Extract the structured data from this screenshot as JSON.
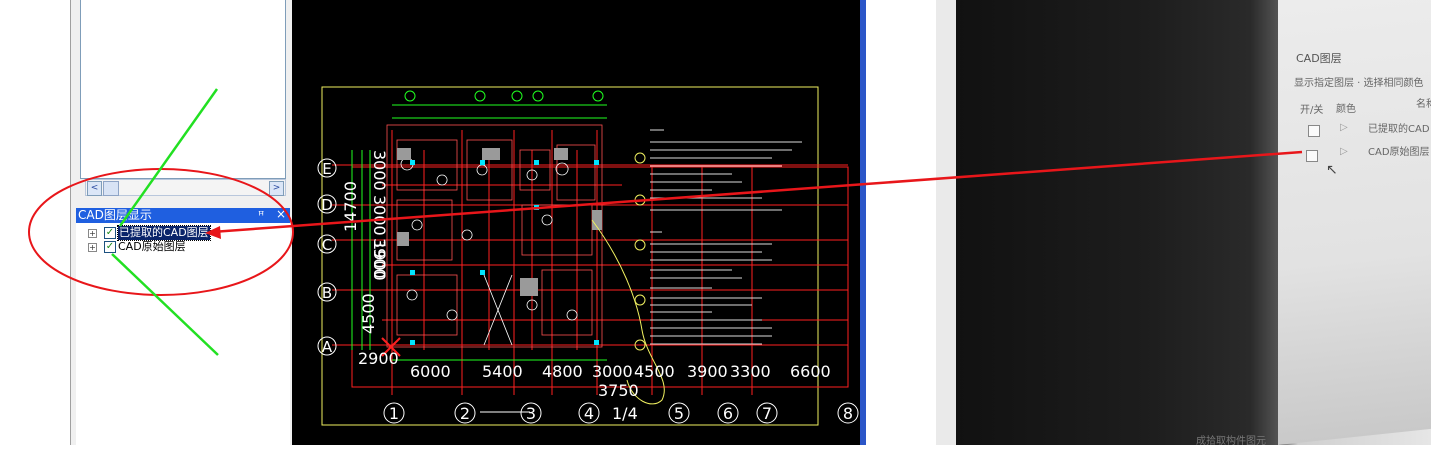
{
  "layer_panel": {
    "title": "CAD图层显示",
    "pin_glyph": "ꟸ",
    "close_glyph": "×",
    "items": [
      {
        "label": "已提取的CAD图层",
        "checked": true,
        "selected": true
      },
      {
        "label": "CAD原始图层",
        "checked": true,
        "selected": false
      }
    ]
  },
  "scrollbar": {
    "left_glyph": "<",
    "right_glyph": ">"
  },
  "cad_drawing": {
    "row_labels": [
      "E",
      "D",
      "C",
      "B",
      "A"
    ],
    "col_numbers": [
      "1",
      "2",
      "3",
      "4",
      "5",
      "6",
      "7",
      "8"
    ],
    "top_dims": [
      "6000",
      "5400",
      "4800",
      "3000",
      "4500",
      "3900",
      "3300",
      "6600"
    ],
    "left_dims": [
      "3000",
      "3900",
      "14700",
      "4500",
      "1900",
      "2900",
      "3000"
    ],
    "extra_dims": [
      "3750",
      "1/4"
    ],
    "colors": {
      "background": "#000000",
      "grid": "#ff2020",
      "frame": "#f0f060",
      "dims": "#20ff20",
      "text": "#ffffff",
      "cyan": "#00e5ff"
    }
  },
  "photo": {
    "panel_title": "CAD图层",
    "filter_text": "显示指定图层 · 选择相同颜色",
    "col_toggle": "开/关",
    "col_color": "颜色",
    "col_name": "名称",
    "rows": [
      "已提取的CAD",
      "CAD原始图层"
    ],
    "bottom_text": "成拾取构件图元"
  },
  "annotations": {
    "ellipse_color": "#e8161a",
    "arrow_color": "#e8161a",
    "pointer_color": "#22e022"
  }
}
